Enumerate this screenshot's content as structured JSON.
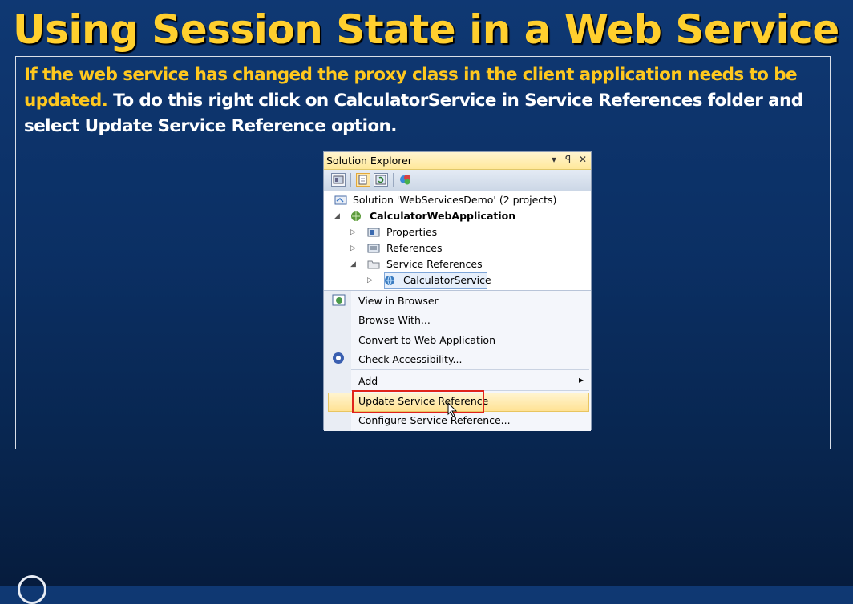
{
  "slide": {
    "title": "Using Session State in a Web Service",
    "body_highlight_1": "If the web service has changed the proxy class in the client application needs to be",
    "body_highlight_2": "updated.",
    "body_rest_1": "To do this right click on CalculatorService in Service References folder and",
    "body_rest_2": "select Update Service Reference option."
  },
  "solution_explorer": {
    "title": "Solution Explorer",
    "controls": {
      "dropdown": "▾",
      "pin": "ꟼ",
      "close": "✕"
    },
    "tree": {
      "solution": "Solution 'WebServicesDemo' (2 projects)",
      "project": "CalculatorWebApplication",
      "properties": "Properties",
      "references": "References",
      "service_references": "Service References",
      "calculator_service": "CalculatorService"
    }
  },
  "context_menu": {
    "items": [
      {
        "label": "View in Browser"
      },
      {
        "label": "Browse With..."
      },
      {
        "label": "Convert to Web Application"
      },
      {
        "label": "Check Accessibility..."
      },
      {
        "label": "Add",
        "submenu_arrow": "▸"
      },
      {
        "label": "Update Service Reference"
      },
      {
        "label": "Configure Service Reference..."
      }
    ]
  },
  "colors": {
    "title": "#ffcf2e",
    "highlight": "#ffc81e",
    "background": "#0b2f63",
    "red_box": "#e0231b"
  }
}
